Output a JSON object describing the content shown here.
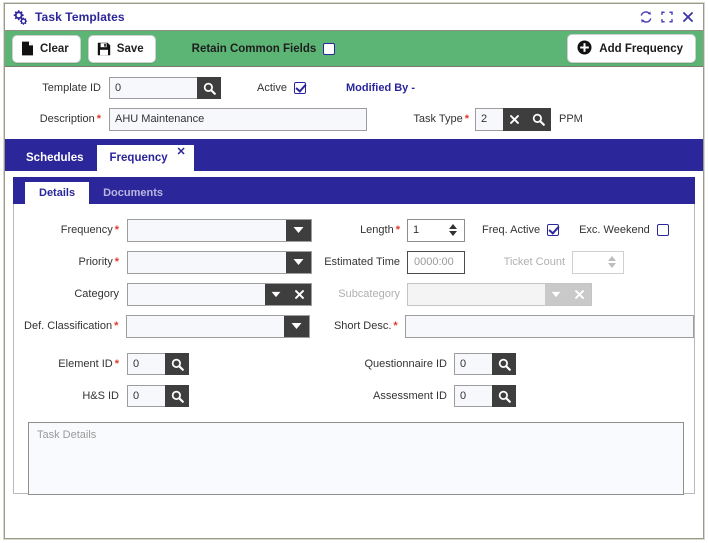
{
  "window": {
    "title": "Task Templates",
    "title_icon": "gears-icon",
    "controls": [
      {
        "name": "refresh-icon",
        "label": "Refresh"
      },
      {
        "name": "maximize-icon",
        "label": "Maximize"
      },
      {
        "name": "close-icon",
        "label": "Close"
      }
    ]
  },
  "toolbar": {
    "clear_label": "Clear",
    "save_label": "Save",
    "retain_label": "Retain Common Fields",
    "retain_checked": false,
    "add_frequency_label": "Add Frequency",
    "accent_green": "#5cb575"
  },
  "header": {
    "template_id_label": "Template ID",
    "template_id_value": "0",
    "active_label": "Active",
    "active_checked": true,
    "modified_by": "Modified By -",
    "description_label": "Description",
    "description_value": "AHU Maintenance",
    "task_type_label": "Task Type",
    "task_type_value": "2",
    "task_type_suffix": "PPM"
  },
  "outer_tabs": [
    {
      "label": "Schedules",
      "active": false,
      "closable": false
    },
    {
      "label": "Frequency",
      "active": true,
      "closable": true,
      "close_glyph": "✕"
    }
  ],
  "inner_tabs": [
    {
      "label": "Details",
      "active": true
    },
    {
      "label": "Documents",
      "active": false
    }
  ],
  "details": {
    "frequency_label": "Frequency",
    "frequency_value": "",
    "priority_label": "Priority",
    "priority_value": "",
    "category_label": "Category",
    "category_value": "",
    "def_classification_label": "Def. Classification",
    "def_classification_value": "",
    "length_label": "Length",
    "length_value": "1",
    "freq_active_label": "Freq. Active",
    "freq_active_checked": true,
    "exc_weekend_label": "Exc. Weekend",
    "exc_weekend_checked": false,
    "estimated_time_label": "Estimated Time",
    "estimated_time_value": "0000:00",
    "ticket_count_label": "Ticket Count",
    "ticket_count_value": "",
    "subcategory_label": "Subcategory",
    "subcategory_value": "",
    "short_desc_label": "Short Desc.",
    "short_desc_value": "",
    "element_id_label": "Element ID",
    "element_id_value": "0",
    "hs_id_label": "H&S ID",
    "hs_id_value": "0",
    "questionnaire_id_label": "Questionnaire ID",
    "questionnaire_id_value": "0",
    "assessment_id_label": "Assessment ID",
    "assessment_id_value": "0",
    "task_details_placeholder": "Task Details",
    "task_details_value": ""
  },
  "colors": {
    "blue": "#2b269a",
    "green": "#5cb575",
    "required_red": "#e0392b",
    "dark_button": "#3e3e3e"
  }
}
